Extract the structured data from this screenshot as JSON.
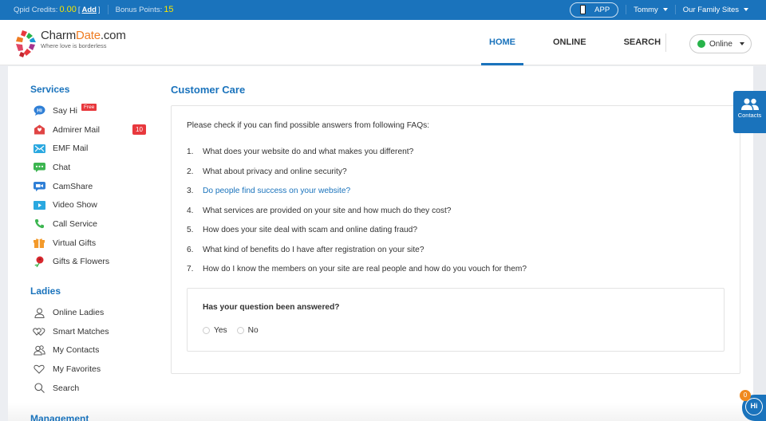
{
  "topbar": {
    "credits_label": "Qpid Credits:",
    "credits_value": "0.00",
    "add_open": "[",
    "add_label": "Add",
    "add_close": "]",
    "bonus_label": "Bonus Points:",
    "bonus_value": "15",
    "app_label": "APP",
    "user_name": "Tommy",
    "family_sites_label": "Our Family Sites"
  },
  "header": {
    "brand_main": "Charm",
    "brand_accent": "Date",
    "brand_suffix": ".com",
    "tagline": "Where love is borderless",
    "nav": [
      {
        "label": "HOME",
        "active": true
      },
      {
        "label": "ONLINE",
        "active": false
      },
      {
        "label": "SEARCH",
        "active": false
      }
    ],
    "status": "Online"
  },
  "sidebar": {
    "services_title": "Services",
    "services": [
      {
        "label": "Say Hi",
        "icon": "say-hi-icon",
        "badge": "Free"
      },
      {
        "label": "Admirer Mail",
        "icon": "admirer-mail-icon",
        "count": "10"
      },
      {
        "label": "EMF Mail",
        "icon": "emf-mail-icon"
      },
      {
        "label": "Chat",
        "icon": "chat-icon"
      },
      {
        "label": "CamShare",
        "icon": "camshare-icon"
      },
      {
        "label": "Video Show",
        "icon": "video-show-icon"
      },
      {
        "label": "Call Service",
        "icon": "phone-icon"
      },
      {
        "label": "Virtual Gifts",
        "icon": "gift-icon"
      },
      {
        "label": "Gifts & Flowers",
        "icon": "rose-icon"
      }
    ],
    "ladies_title": "Ladies",
    "ladies": [
      {
        "label": "Online Ladies",
        "icon": "person-icon"
      },
      {
        "label": "Smart Matches",
        "icon": "hearts-icon"
      },
      {
        "label": "My Contacts",
        "icon": "contacts-icon"
      },
      {
        "label": "My Favorites",
        "icon": "heart-icon"
      },
      {
        "label": "Search",
        "icon": "search-icon"
      }
    ],
    "management_title": "Management"
  },
  "main": {
    "title": "Customer Care",
    "intro": "Please check if you can find possible answers from following FAQs:",
    "faqs": [
      {
        "num": "1.",
        "text": "What does your website do and what makes you different?"
      },
      {
        "num": "2.",
        "text": "What about privacy and online security?"
      },
      {
        "num": "3.",
        "text": "Do people find success on your website?"
      },
      {
        "num": "4.",
        "text": "What services are provided on your site and how much do they cost?"
      },
      {
        "num": "5.",
        "text": "How does your site deal with scam and online dating fraud?"
      },
      {
        "num": "6.",
        "text": "What kind of benefits do I have after registration on your site?"
      },
      {
        "num": "7.",
        "text": "How do I know the members on your site are real people and how do you vouch for them?"
      }
    ],
    "question": "Has your question been answered?",
    "options": [
      "Yes",
      "No"
    ]
  },
  "floating": {
    "contacts_label": "Contacts",
    "hi_label": "Hi",
    "hi_count": "0"
  },
  "colors": {
    "brand_blue": "#1a73bc",
    "accent_yellow": "#f4e400",
    "badge_red": "#e8383d",
    "online_green": "#27b34a"
  }
}
